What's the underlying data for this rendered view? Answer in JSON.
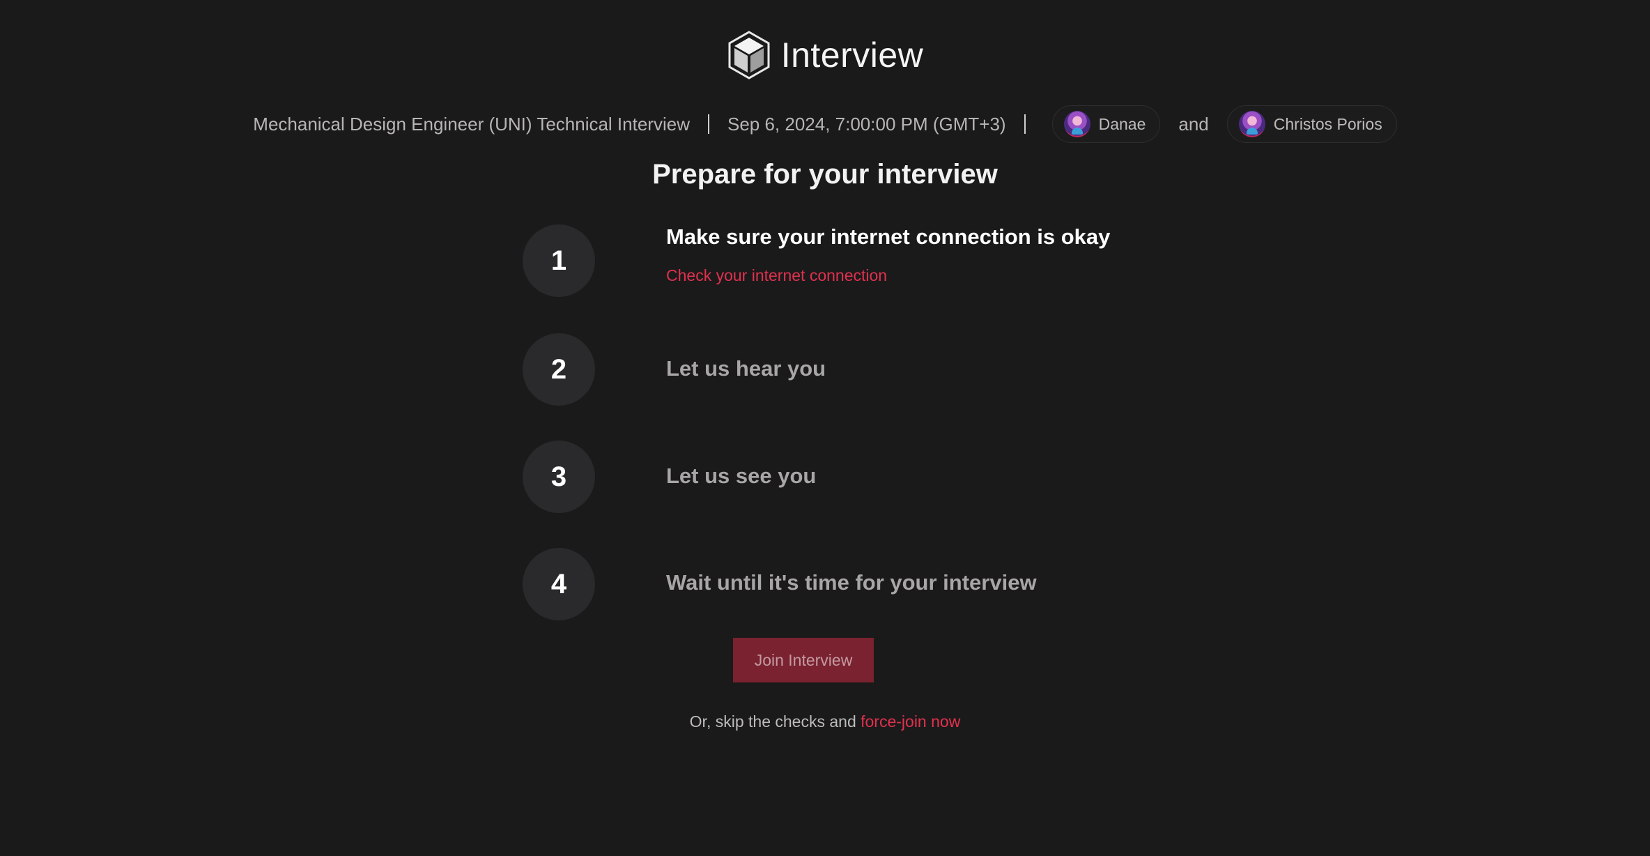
{
  "brand": {
    "title": "Interview",
    "logo_icon": "cube-icon"
  },
  "meta": {
    "interview_title": "Mechanical Design Engineer (UNI) Technical Interview",
    "datetime": "Sep 6, 2024, 7:00:00 PM (GMT+3)",
    "participants": [
      {
        "name": "Danae",
        "icon": "avatar"
      },
      {
        "name": "Christos Porios",
        "icon": "avatar"
      }
    ],
    "conjunction": "and"
  },
  "heading": "Prepare for your interview",
  "steps": [
    {
      "number": "1",
      "title": "Make sure your internet connection is okay",
      "link": "Check your internet connection",
      "state": "active"
    },
    {
      "number": "2",
      "title": "Let us hear you",
      "state": "pending"
    },
    {
      "number": "3",
      "title": "Let us see you",
      "state": "pending"
    },
    {
      "number": "4",
      "title": "Wait until it's time for your interview",
      "state": "pending"
    }
  ],
  "join_button": "Join Interview",
  "skip": {
    "prefix": "Or, skip the checks and ",
    "link": "force-join now"
  },
  "colors": {
    "background": "#1b1a1a",
    "accent": "#e0314f",
    "button": "#7a2230",
    "step_circle": "#2a292b"
  }
}
